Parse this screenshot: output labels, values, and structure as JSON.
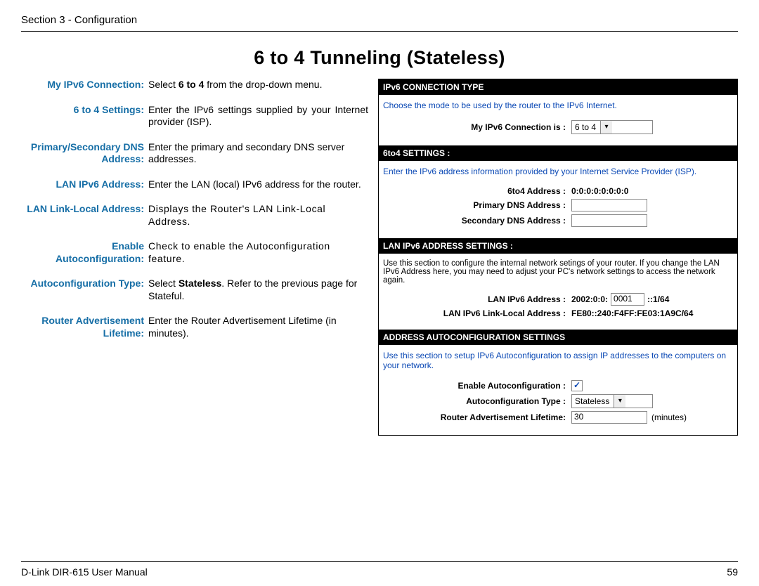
{
  "header": {
    "section": "Section 3 - Configuration"
  },
  "title": "6 to 4 Tunneling (Stateless)",
  "defs": {
    "r1": {
      "label": "My IPv6 Connection:",
      "pre": "Select ",
      "bold": "6 to 4",
      "post": " from the drop-down menu."
    },
    "r2": {
      "label": "6 to 4 Settings:",
      "text": "Enter the IPv6 settings supplied by your Internet provider (ISP)."
    },
    "r3": {
      "label": "Primary/Secondary DNS Address:",
      "text": "Enter the primary and secondary DNS server addresses."
    },
    "r4": {
      "label": "LAN IPv6 Address:",
      "text": "Enter the LAN (local) IPv6 address for the router."
    },
    "r5": {
      "label": "LAN Link-Local Address:",
      "text": "Displays the Router's LAN Link-Local Address."
    },
    "r6": {
      "label": "Enable Autoconfiguration:",
      "text": "Check to enable the Autoconfiguration feature."
    },
    "r7": {
      "label": "Autoconfiguration Type:",
      "pre": "Select ",
      "bold": "Stateless",
      "post": ". Refer to the previous page for Stateful."
    },
    "r8": {
      "label": "Router Advertisement Lifetime:",
      "text": "Enter the Router Advertisement Lifetime (in minutes)."
    }
  },
  "panels": {
    "p1": {
      "bar": "IPv6 CONNECTION TYPE",
      "msg": "Choose the mode to be used by the router to the IPv6 Internet.",
      "rowLabel": "My IPv6 Connection is :",
      "dropdown": "6 to 4"
    },
    "p2": {
      "bar": "6to4 SETTINGS :",
      "msg": "Enter the IPv6 address information provided by your Internet Service Provider (ISP).",
      "r1l": "6to4 Address :",
      "r1v": "0:0:0:0:0:0:0:0",
      "r2l": "Primary DNS Address :",
      "r3l": "Secondary DNS Address :"
    },
    "p3": {
      "bar": "LAN IPv6 ADDRESS SETTINGS :",
      "note": "Use this section to configure the internal network setings of your router. If you change the LAN IPv6 Address here, you may need to adjust your PC's network settings to access the network again.",
      "r1l": "LAN IPv6 Address :",
      "r1a": "2002:0:0:",
      "r1b": "0001",
      "r1c": "::1/64",
      "r2l": "LAN IPv6 Link-Local Address :",
      "r2v": "FE80::240:F4FF:FE03:1A9C/64"
    },
    "p4": {
      "bar": "ADDRESS AUTOCONFIGURATION SETTINGS",
      "msg": "Use this section to setup IPv6 Autoconfiguration to assign IP addresses to the computers on your network.",
      "r1l": "Enable Autoconfiguration :",
      "check": "✓",
      "r2l": "Autoconfiguration Type :",
      "r2v": "Stateless",
      "r3l": "Router Advertisement Lifetime:",
      "r3v": "30",
      "r3u": "(minutes)"
    }
  },
  "footer": {
    "left": "D-Link DIR-615 User Manual",
    "right": "59"
  }
}
